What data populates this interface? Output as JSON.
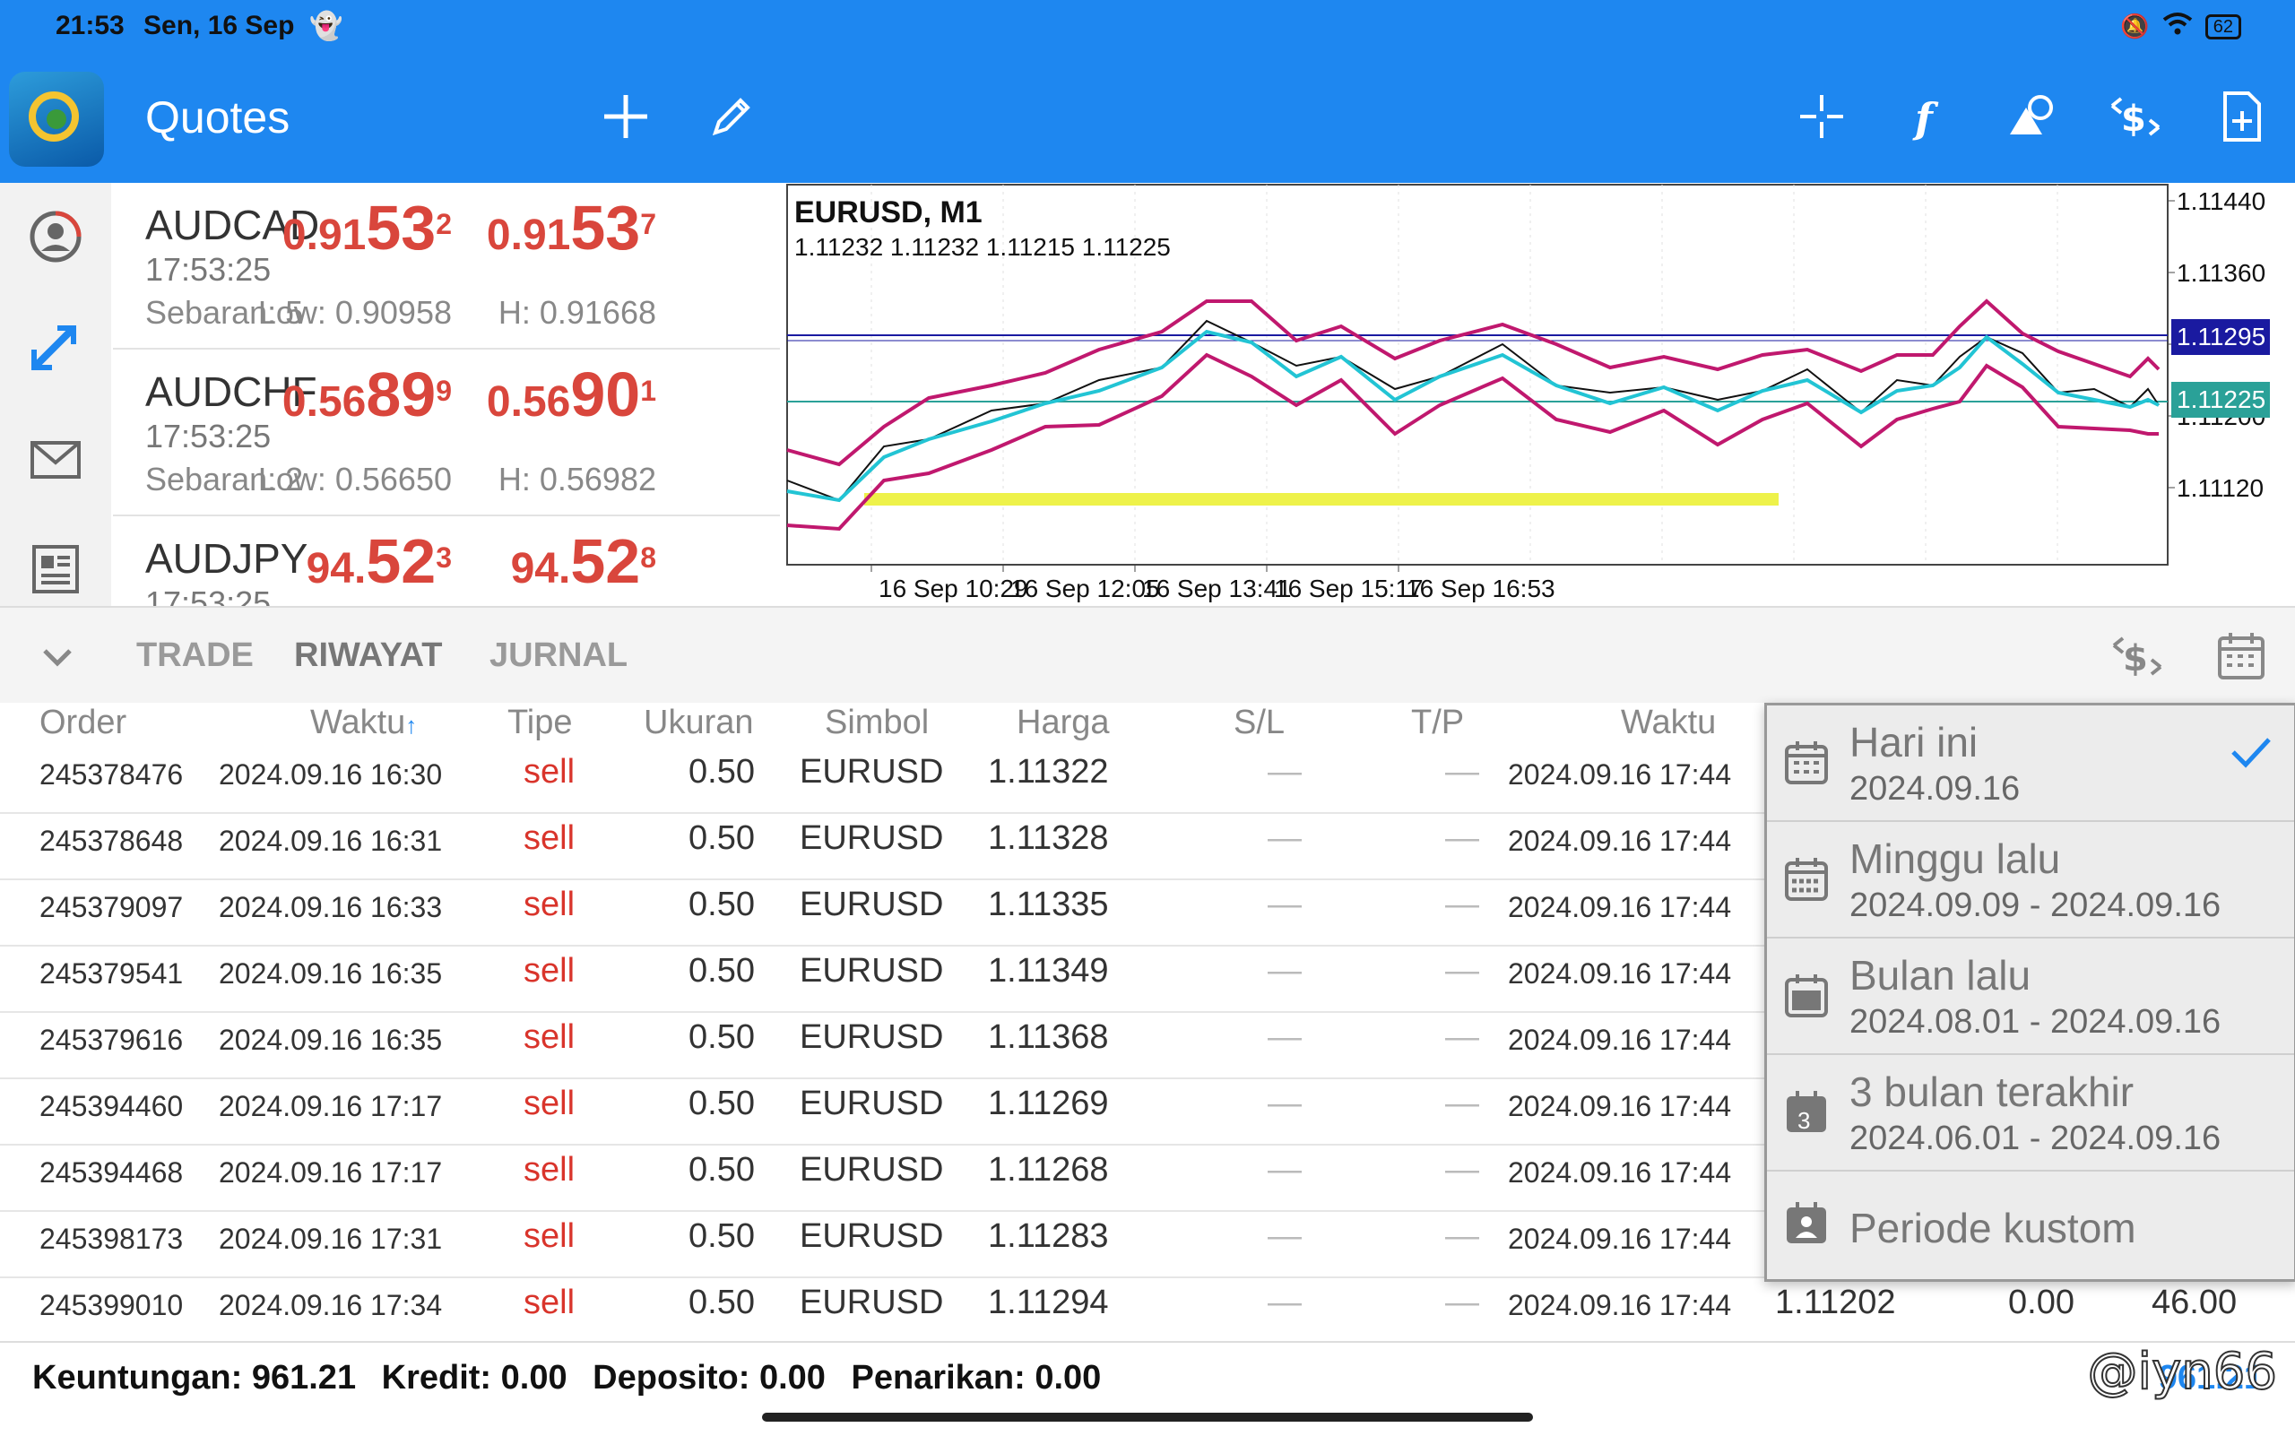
{
  "status_bar": {
    "time": "21:53",
    "date": "Sen, 16 Sep",
    "battery": "62"
  },
  "app_bar": {
    "title": "Quotes"
  },
  "quotes": [
    {
      "symbol": "AUDCAD",
      "time": "17:53:25",
      "spread": "Sebaran: 5",
      "bid_pre": "0.91",
      "bid_big": "53",
      "bid_sup": "2",
      "ask_pre": "0.91",
      "ask_big": "53",
      "ask_sup": "7",
      "low": "Low: 0.90958",
      "high": "H: 0.91668"
    },
    {
      "symbol": "AUDCHF",
      "time": "17:53:25",
      "spread": "Sebaran: 2",
      "bid_pre": "0.56",
      "bid_big": "89",
      "bid_sup": "9",
      "ask_pre": "0.56",
      "ask_big": "90",
      "ask_sup": "1",
      "low": "Low: 0.56650",
      "high": "H: 0.56982"
    },
    {
      "symbol": "AUDJPY",
      "time": "17:53:25",
      "spread": "",
      "bid_pre": "94.",
      "bid_big": "52",
      "bid_sup": "3",
      "ask_pre": "94.",
      "ask_big": "52",
      "ask_sup": "8",
      "low": "",
      "high": ""
    }
  ],
  "chart": {
    "title": "EURUSD, M1",
    "ohlc": "1.11232 1.11232 1.11215 1.11225",
    "y_ticks": [
      "1.11440",
      "1.11360",
      "1.11280",
      "1.11200",
      "1.11120"
    ],
    "x_ticks": [
      "16 Sep 10:29",
      "16 Sep 12:05",
      "16 Sep 13:41",
      "16 Sep 15:17",
      "16 Sep 16:53"
    ],
    "ask_label": "1.11295",
    "bid_label": "1.11225",
    "colors": {
      "price": "#111111",
      "band": "#c0186e",
      "ma": "#22c4d4",
      "ask_line": "#1a1aa0",
      "bid_line": "#2aa198",
      "highlight": "#eef24a"
    }
  },
  "tabs": {
    "trade": "TRADE",
    "history": "RIWAYAT",
    "journal": "JURNAL"
  },
  "table": {
    "headers": {
      "order": "Order",
      "time": "Waktu",
      "type": "Tipe",
      "size": "Ukuran",
      "symbol": "Simbol",
      "price": "Harga",
      "sl": "S/L",
      "tp": "T/P",
      "close_time": "Waktu"
    },
    "rows": [
      {
        "order": "245378476",
        "time": "2024.09.16 16:30",
        "type": "sell",
        "size": "0.50",
        "symbol": "EURUSD",
        "price": "1.11322",
        "sl": "—",
        "tp": "—",
        "close_time": "2024.09.16 17:44"
      },
      {
        "order": "245378648",
        "time": "2024.09.16 16:31",
        "type": "sell",
        "size": "0.50",
        "symbol": "EURUSD",
        "price": "1.11328",
        "sl": "—",
        "tp": "—",
        "close_time": "2024.09.16 17:44"
      },
      {
        "order": "245379097",
        "time": "2024.09.16 16:33",
        "type": "sell",
        "size": "0.50",
        "symbol": "EURUSD",
        "price": "1.11335",
        "sl": "—",
        "tp": "—",
        "close_time": "2024.09.16 17:44"
      },
      {
        "order": "245379541",
        "time": "2024.09.16 16:35",
        "type": "sell",
        "size": "0.50",
        "symbol": "EURUSD",
        "price": "1.11349",
        "sl": "—",
        "tp": "—",
        "close_time": "2024.09.16 17:44"
      },
      {
        "order": "245379616",
        "time": "2024.09.16 16:35",
        "type": "sell",
        "size": "0.50",
        "symbol": "EURUSD",
        "price": "1.11368",
        "sl": "—",
        "tp": "—",
        "close_time": "2024.09.16 17:44"
      },
      {
        "order": "245394460",
        "time": "2024.09.16 17:17",
        "type": "sell",
        "size": "0.50",
        "symbol": "EURUSD",
        "price": "1.11269",
        "sl": "—",
        "tp": "—",
        "close_time": "2024.09.16 17:44"
      },
      {
        "order": "245394468",
        "time": "2024.09.16 17:17",
        "type": "sell",
        "size": "0.50",
        "symbol": "EURUSD",
        "price": "1.11268",
        "sl": "—",
        "tp": "—",
        "close_time": "2024.09.16 17:44"
      },
      {
        "order": "245398173",
        "time": "2024.09.16 17:31",
        "type": "sell",
        "size": "0.50",
        "symbol": "EURUSD",
        "price": "1.11283",
        "sl": "—",
        "tp": "—",
        "close_time": "2024.09.16 17:44"
      },
      {
        "order": "245399010",
        "time": "2024.09.16 17:34",
        "type": "sell",
        "size": "0.50",
        "symbol": "EURUSD",
        "price": "1.11294",
        "sl": "—",
        "tp": "—",
        "close_time": "2024.09.16 17:44",
        "close_price": "1.11202",
        "swap": "0.00",
        "profit": "46.00"
      }
    ]
  },
  "period_menu": [
    {
      "label": "Hari ini",
      "range": "2024.09.16",
      "selected": true
    },
    {
      "label": "Minggu lalu",
      "range": "2024.09.09 - 2024.09.16"
    },
    {
      "label": "Bulan lalu",
      "range": "2024.08.01 - 2024.09.16"
    },
    {
      "label": "3 bulan terakhir",
      "range": "2024.06.01 - 2024.09.16",
      "badge": "3"
    },
    {
      "label": "Periode kustom",
      "range": ""
    }
  ],
  "footer": {
    "profit": "Keuntungan: 961.21",
    "credit": "Kredit: 0.00",
    "deposit": "Deposito: 0.00",
    "withdrawal": "Penarikan: 0.00",
    "total": "961.21",
    "watermark": "@iyn66"
  }
}
